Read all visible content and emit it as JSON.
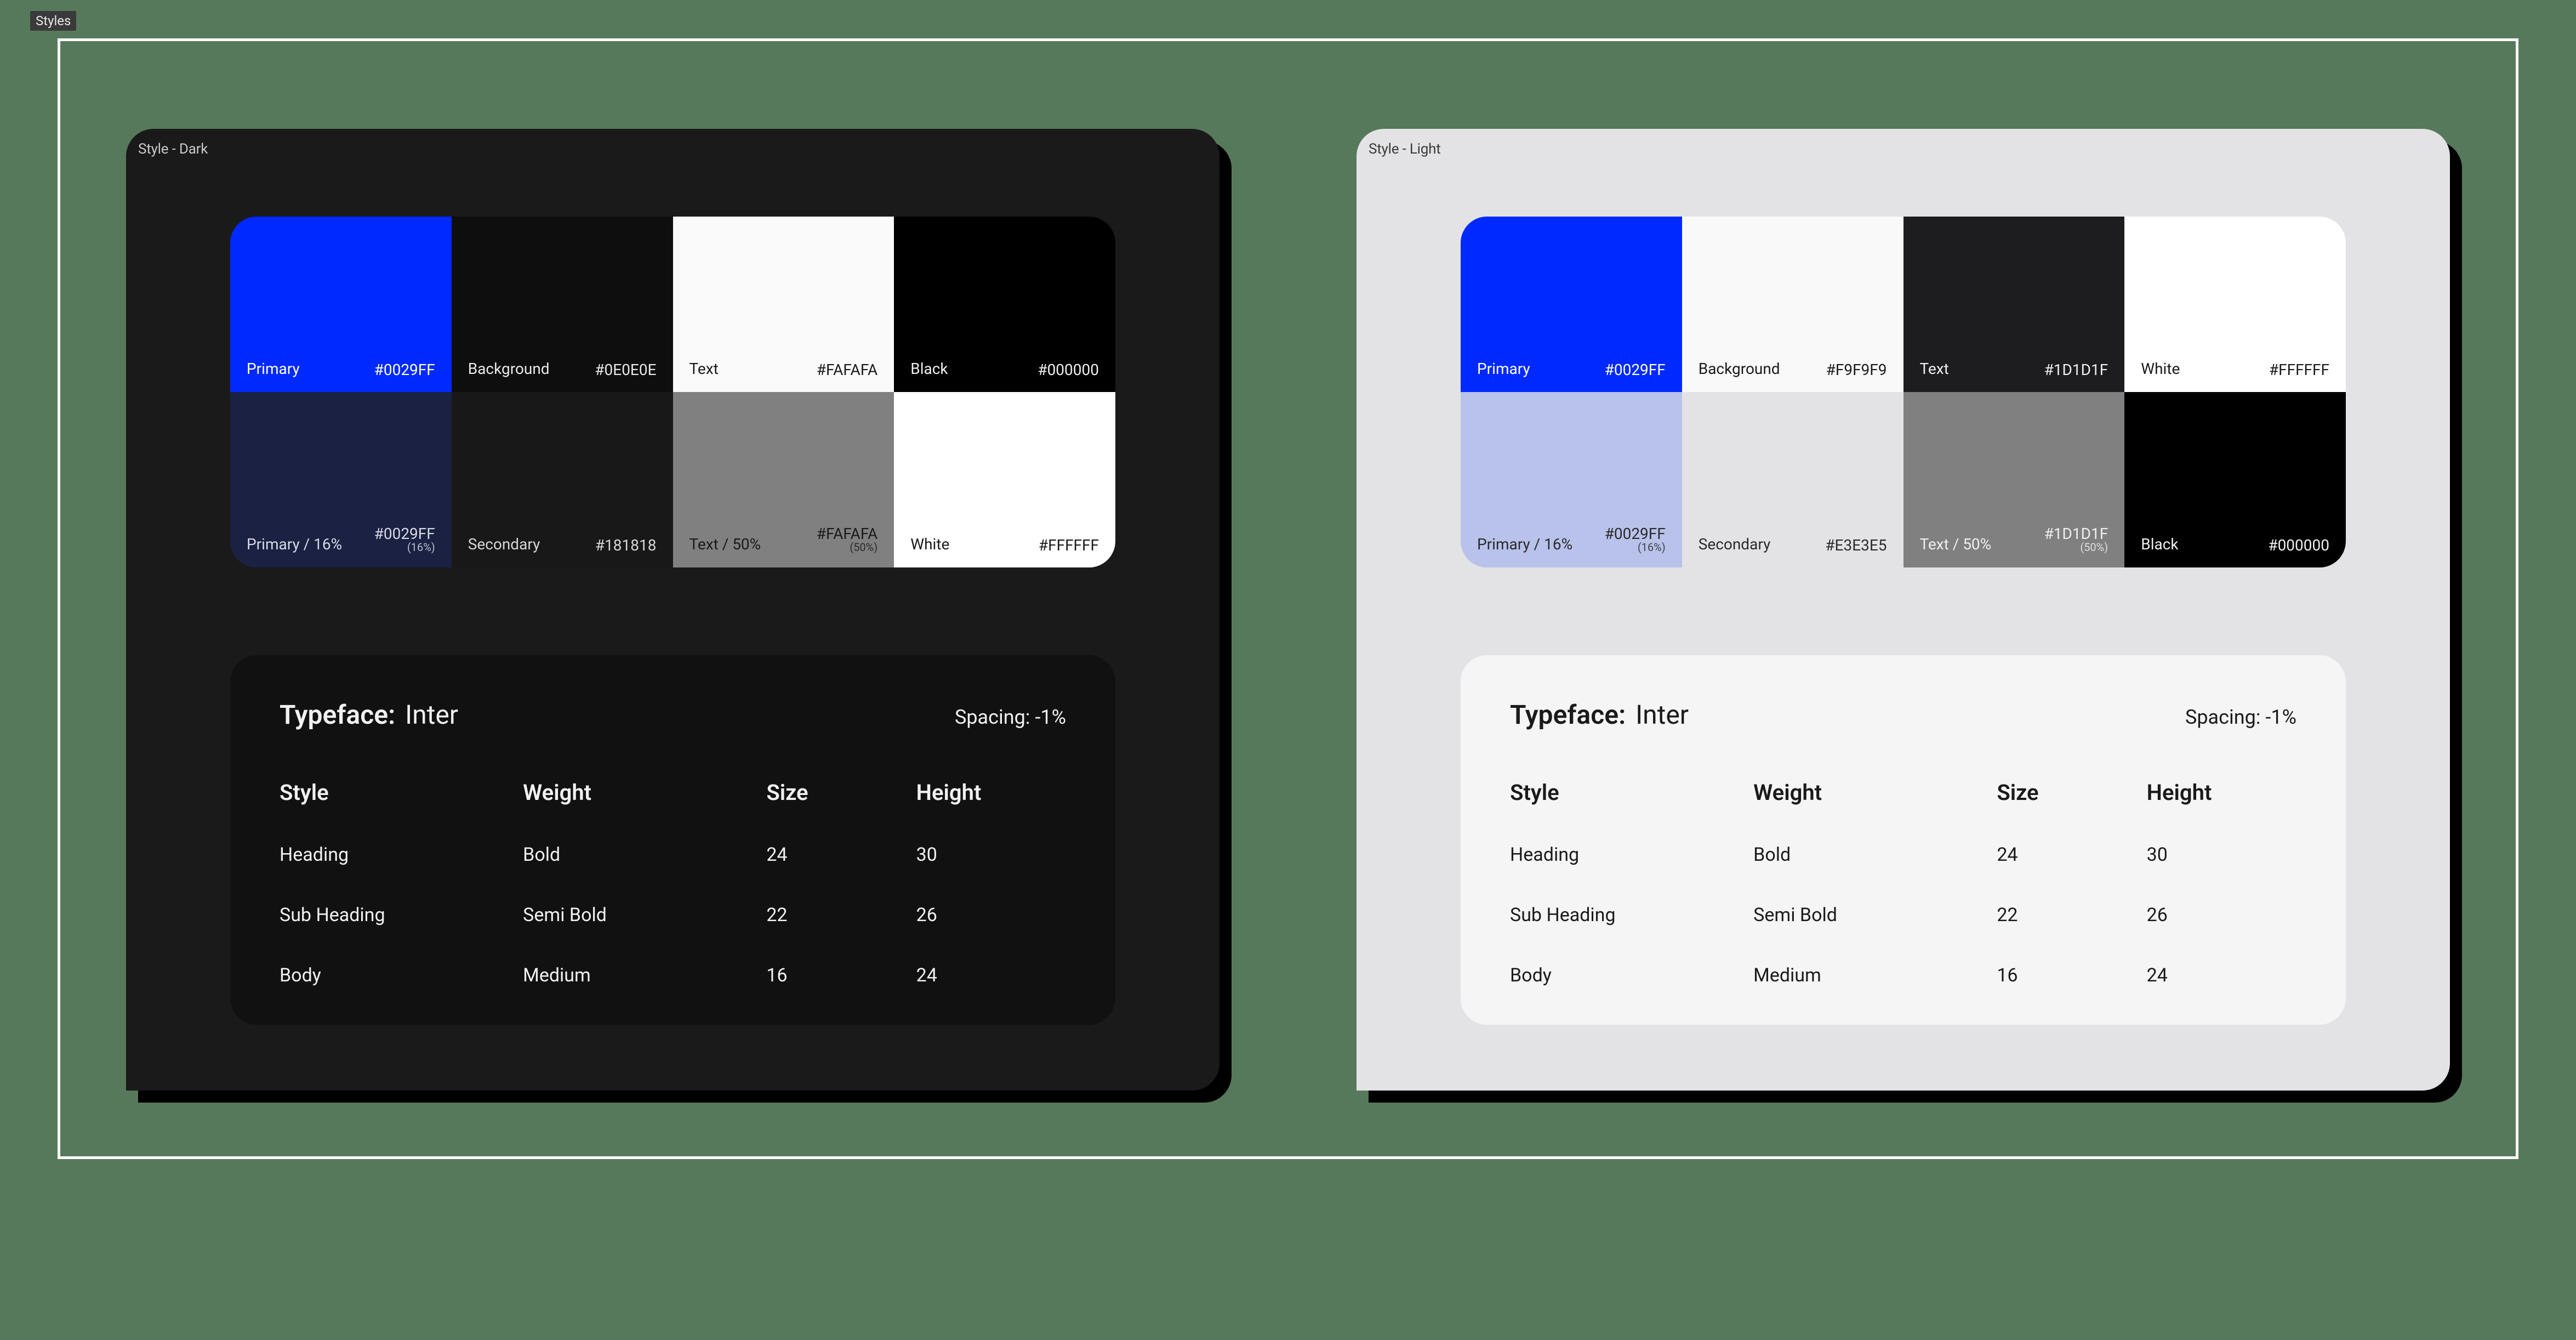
{
  "badge": "Styles",
  "panels": {
    "dark": {
      "label": "Style - Dark",
      "swatches": [
        {
          "name": "Primary",
          "hex": "#0029FF",
          "sub": "",
          "bg": "#0029FF",
          "fg": "#ffffff"
        },
        {
          "name": "Background",
          "hex": "#0E0E0E",
          "sub": "",
          "bg": "#0E0E0E",
          "fg": "#e9e9e9"
        },
        {
          "name": "Text",
          "hex": "#FAFAFA",
          "sub": "",
          "bg": "#FAFAFA",
          "fg": "#1a1a1a"
        },
        {
          "name": "Black",
          "hex": "#000000",
          "sub": "",
          "bg": "#000000",
          "fg": "#f0f0f0"
        },
        {
          "name": "Primary / 16%",
          "hex": "#0029FF",
          "sub": "(16%)",
          "bg": "#1a2142",
          "fg": "#d6dae6"
        },
        {
          "name": "Secondary",
          "hex": "#181818",
          "sub": "",
          "bg": "#181818",
          "fg": "#d7d7d7"
        },
        {
          "name": "Text / 50%",
          "hex": "#FAFAFA",
          "sub": "(50%)",
          "bg": "#808080",
          "fg": "#1a1a1a"
        },
        {
          "name": "White",
          "hex": "#FFFFFF",
          "sub": "",
          "bg": "#FFFFFF",
          "fg": "#1a1a1a"
        }
      ]
    },
    "light": {
      "label": "Style - Light",
      "swatches": [
        {
          "name": "Primary",
          "hex": "#0029FF",
          "sub": "",
          "bg": "#0029FF",
          "fg": "#ffffff"
        },
        {
          "name": "Background",
          "hex": "#F9F9F9",
          "sub": "",
          "bg": "#F9F9F9",
          "fg": "#1a1a1a"
        },
        {
          "name": "Text",
          "hex": "#1D1D1F",
          "sub": "",
          "bg": "#1D1D1F",
          "fg": "#efefef"
        },
        {
          "name": "White",
          "hex": "#FFFFFF",
          "sub": "",
          "bg": "#FFFFFF",
          "fg": "#1a1a1a"
        },
        {
          "name": "Primary / 16%",
          "hex": "#0029FF",
          "sub": "(16%)",
          "bg": "#b8c2ea",
          "fg": "#2a2a2a"
        },
        {
          "name": "Secondary",
          "hex": "#E3E3E5",
          "sub": "",
          "bg": "#E3E3E5",
          "fg": "#2a2a2a"
        },
        {
          "name": "Text / 50%",
          "hex": "#1D1D1F",
          "sub": "(50%)",
          "bg": "#808081",
          "fg": "#efefef"
        },
        {
          "name": "Black",
          "hex": "#000000",
          "sub": "",
          "bg": "#000000",
          "fg": "#f0f0f0"
        }
      ]
    }
  },
  "typography": {
    "typeface_label": "Typeface:",
    "typeface_name": "Inter",
    "spacing_label": "Spacing:",
    "spacing_value": "-1%",
    "columns": [
      "Style",
      "Weight",
      "Size",
      "Height"
    ],
    "rows": [
      {
        "style": "Heading",
        "weight": "Bold",
        "size": "24",
        "height": "30"
      },
      {
        "style": "Sub Heading",
        "weight": "Semi Bold",
        "size": "22",
        "height": "26"
      },
      {
        "style": "Body",
        "weight": "Medium",
        "size": "16",
        "height": "24"
      }
    ]
  }
}
